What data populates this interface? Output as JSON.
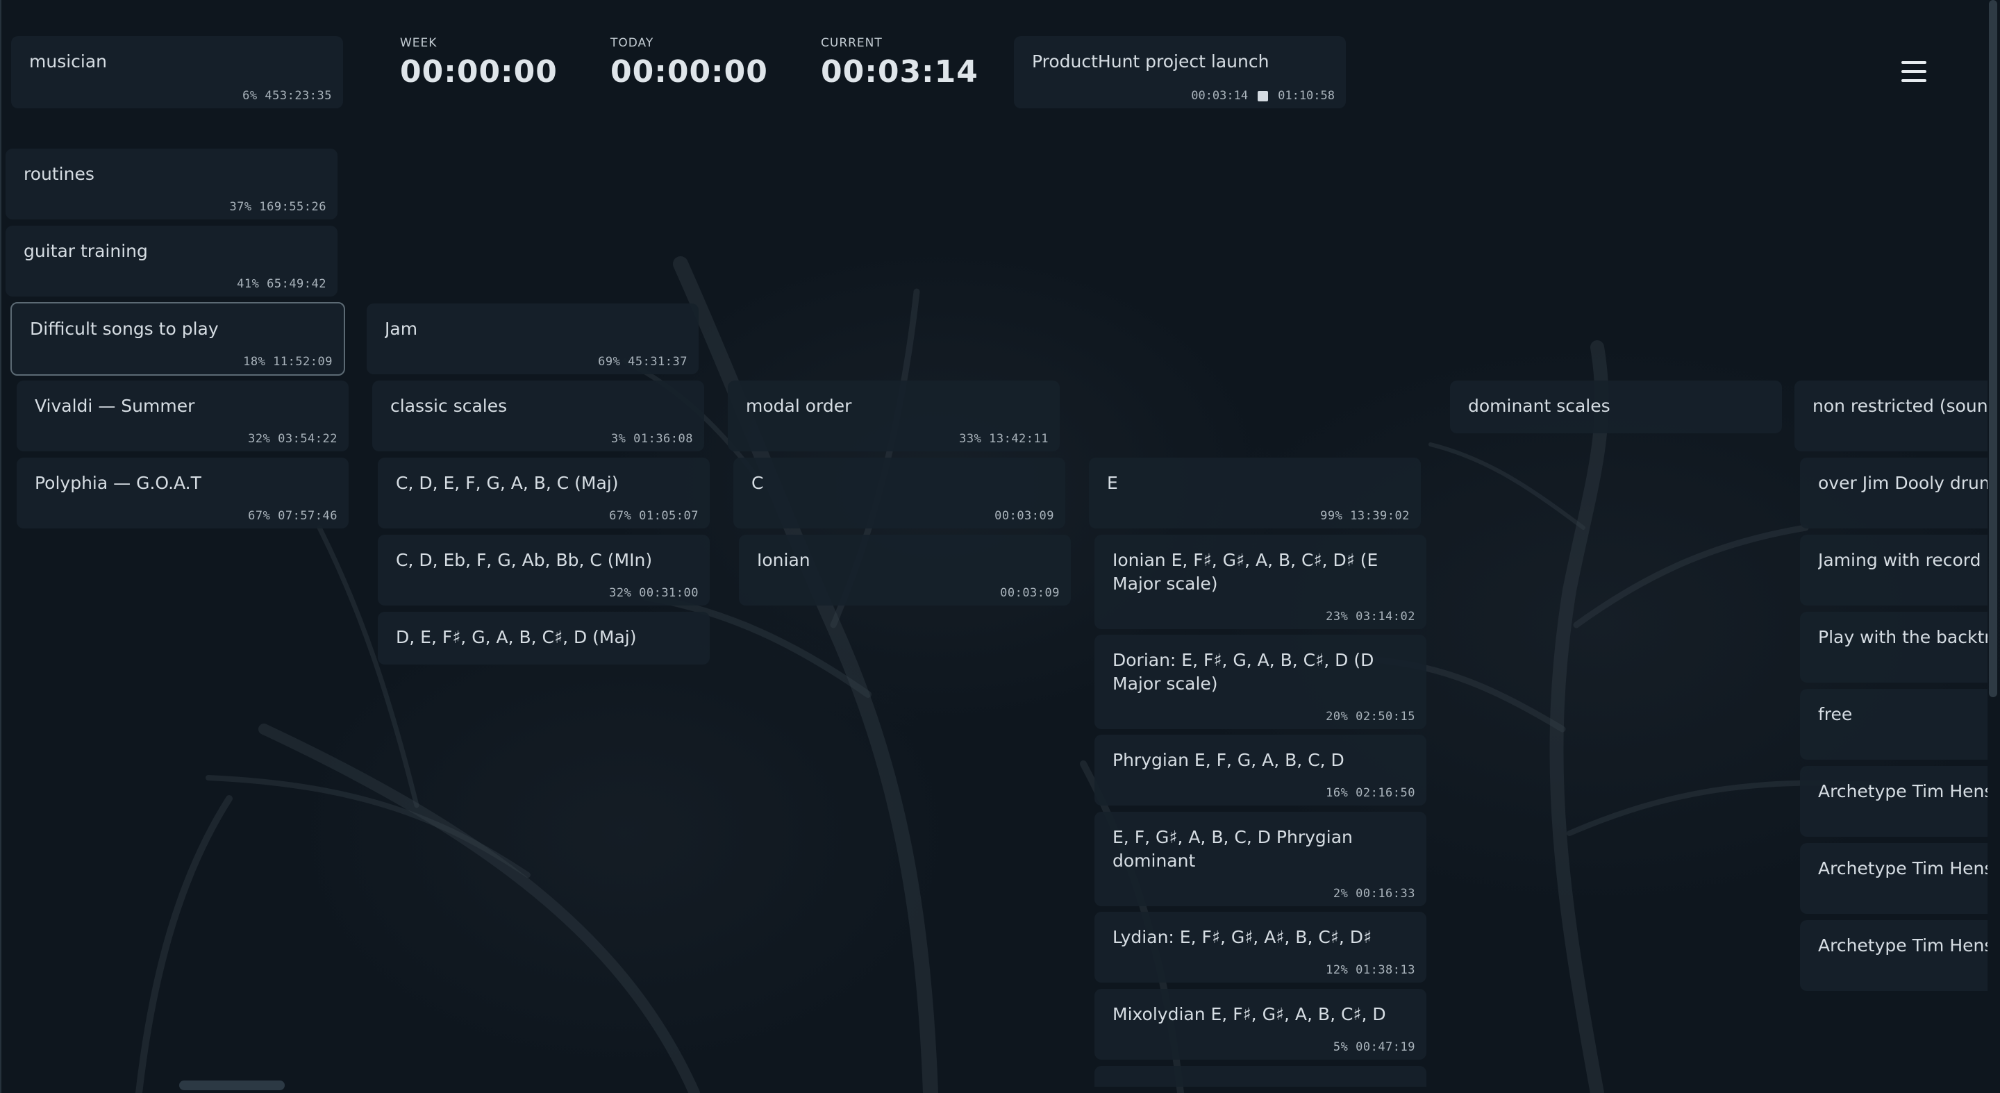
{
  "header": {
    "root_task": {
      "title": "musician",
      "stats": "6% 453:23:35"
    },
    "timers": [
      {
        "label": "WEEK",
        "value": "00:00:00"
      },
      {
        "label": "TODAY",
        "value": "00:00:00"
      },
      {
        "label": "CURRENT",
        "value": "00:03:14"
      }
    ],
    "current_task": {
      "title": "ProductHunt project launch",
      "elapsed": "00:03:14",
      "total": "01:10:58"
    },
    "menu_icon": "hamburger-menu-icon"
  },
  "columns": {
    "col1": [
      {
        "title": "routines",
        "stats": "37% 169:55:26"
      },
      {
        "title": "guitar training",
        "stats": "41% 65:49:42"
      },
      {
        "title": "Difficult songs to play",
        "stats": "18% 11:52:09"
      },
      {
        "title": "Vivaldi — Summer",
        "stats": "32% 03:54:22"
      },
      {
        "title": "Polyphia — G.O.A.T",
        "stats": "67% 07:57:46"
      }
    ],
    "col2": [
      {
        "title": "Jam",
        "stats": "69% 45:31:37"
      },
      {
        "title": "classic scales",
        "stats": "3% 01:36:08"
      },
      {
        "title": "C, D, E, F, G, A, B, C (Maj)",
        "stats": "67% 01:05:07"
      },
      {
        "title": "C, D, Eb, F, G, Ab, Bb, C (MIn)",
        "stats": "32% 00:31:00"
      },
      {
        "title": "D, E, F♯, G, A, B, C♯, D (Maj)",
        "stats": ""
      }
    ],
    "col3": [
      {
        "title": "modal order",
        "stats": "33% 13:42:11"
      },
      {
        "title": "C",
        "stats": "00:03:09"
      },
      {
        "title": "Ionian",
        "stats": "00:03:09"
      }
    ],
    "col4": [
      {
        "title": "E",
        "stats": "99% 13:39:02"
      },
      {
        "title": "Ionian E, F♯, G♯, A, B, C♯, D♯ (E Major scale)",
        "stats": "23% 03:14:02"
      },
      {
        "title": "Dorian: E, F♯, G, A, B, C♯, D (D Major scale)",
        "stats": "20% 02:50:15"
      },
      {
        "title": "Phrygian E, F, G, A, B, C, D",
        "stats": "16% 02:16:50"
      },
      {
        "title": "E, F, G♯, A, B, C,  D Phrygian dominant",
        "stats": "2% 00:16:33"
      },
      {
        "title": "Lydian: E, F♯, G♯, A♯, B, C♯, D♯",
        "stats": "12% 01:38:13"
      },
      {
        "title": "Mixolydian E, F♯, G♯, A, B, C♯, D",
        "stats": "5% 00:47:19"
      }
    ],
    "col5": [
      {
        "title": "dominant scales",
        "stats": ""
      }
    ],
    "col6": [
      {
        "title": "non restricted (sounds",
        "stats": ""
      },
      {
        "title": "over Jim Dooly drum",
        "stats": ""
      },
      {
        "title": "Jaming with record",
        "stats": ""
      },
      {
        "title": "Play with the backtra",
        "stats": ""
      },
      {
        "title": "free",
        "stats": ""
      },
      {
        "title": "Archetype Tim Hens",
        "stats": ""
      },
      {
        "title": "Archetype Tim Hens",
        "stats": ""
      },
      {
        "title": "Archetype Tim Hens",
        "stats": ""
      }
    ]
  }
}
